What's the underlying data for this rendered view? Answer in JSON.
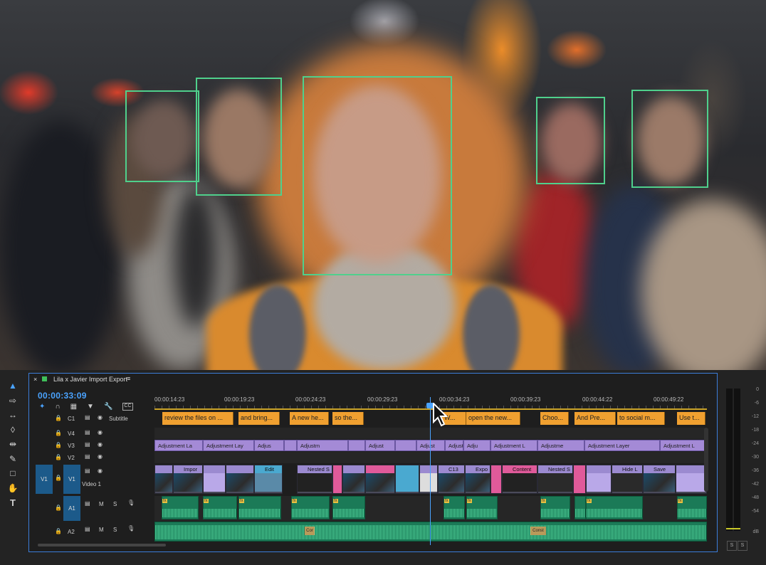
{
  "sequence": {
    "tab_title": "Lila x Javier Import Export",
    "timecode": "00:00:33:09",
    "ruler_ticks": [
      "00:00:14:23",
      "00:00:19:23",
      "00:00:24:23",
      "00:00:29:23",
      "00:00:34:23",
      "00:00:39:23",
      "00:00:44:22",
      "00:00:49:22"
    ]
  },
  "tracks": {
    "c1": {
      "id": "C1",
      "name": "Subtitle"
    },
    "v4": {
      "id": "V4"
    },
    "v3": {
      "id": "V3"
    },
    "v2": {
      "id": "V2"
    },
    "v1": {
      "src": "V1",
      "id": "V1",
      "name": "Video 1"
    },
    "a1": {
      "id": "A1",
      "m": "M",
      "s": "S"
    },
    "a2": {
      "id": "A2",
      "m": "M",
      "s": "S"
    }
  },
  "subtitles": [
    "review the files on ...",
    "and bring...",
    "A new he...",
    "so the...",
    "W...",
    "open the new...",
    "Choo...",
    "And Pre...",
    "to social m...",
    "Use t..."
  ],
  "adjustment_labels": [
    "Adjustment La",
    "Adjustment Lay",
    "Adjus",
    "Adjustm",
    "Adjust",
    "Adju",
    "Adjustment L",
    "Adjustme",
    "Adjustment Layer",
    "Adjustment L"
  ],
  "video_labels": [
    "Impor",
    "Edit",
    "Nested S",
    "C13",
    "Expo",
    "Content",
    "Nested S",
    "Hide L",
    "Save"
  ],
  "audio_labels": {
    "con1": "Cor",
    "con2": "Const"
  },
  "meters": {
    "labels": [
      "0",
      "-6",
      "-12",
      "-18",
      "-24",
      "-30",
      "-36",
      "-42",
      "-48",
      "-54",
      "dB"
    ],
    "solo": [
      "S",
      "S"
    ]
  },
  "colors": {
    "face_box": "#4fd08c",
    "accent": "#4aa3ff",
    "subtitle": "#f0a030",
    "adjustment": "#a48ad6",
    "audio": "#1b7a57"
  }
}
